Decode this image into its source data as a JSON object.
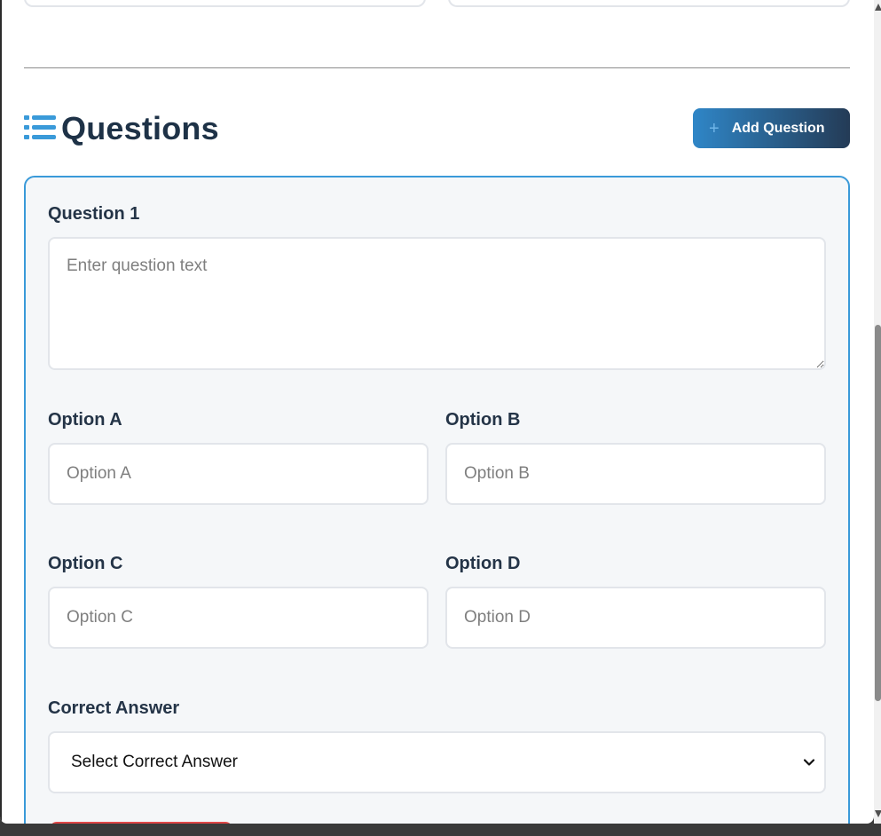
{
  "section": {
    "title": "Questions",
    "icon": "list-icon",
    "add_button_label": "Add Question",
    "add_button_icon": "plus-icon"
  },
  "question": {
    "label": "Question 1",
    "text_placeholder": "Enter question text",
    "options": [
      {
        "label": "Option A",
        "placeholder": "Option A"
      },
      {
        "label": "Option B",
        "placeholder": "Option B"
      },
      {
        "label": "Option C",
        "placeholder": "Option C"
      },
      {
        "label": "Option D",
        "placeholder": "Option D"
      }
    ],
    "correct_answer_label": "Correct Answer",
    "correct_answer_selected": "Select Correct Answer"
  },
  "colors": {
    "accent": "#3a9ad9",
    "title": "#1e3247",
    "danger": "#e04646"
  }
}
